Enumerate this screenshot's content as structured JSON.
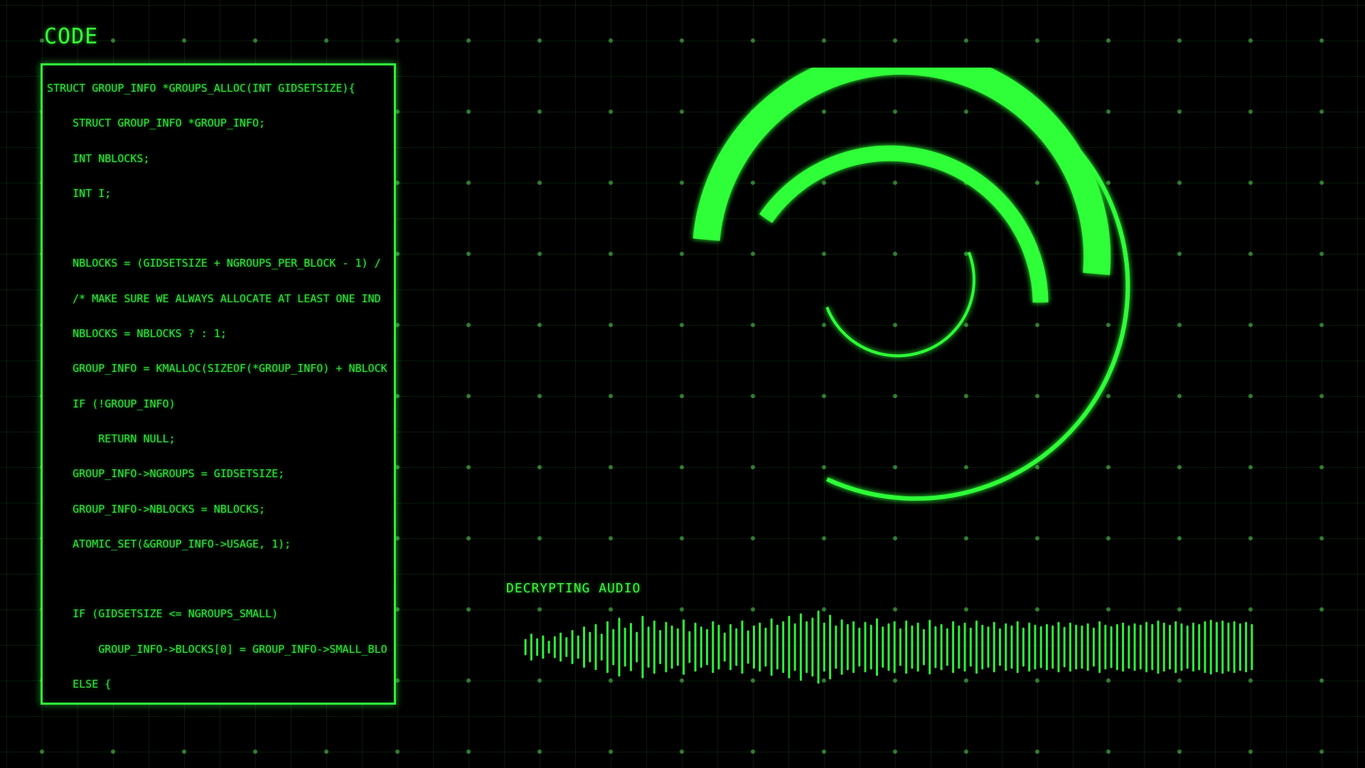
{
  "panel": {
    "title": "CODE",
    "lines": [
      "STRUCT GROUP_INFO *GROUPS_ALLOC(INT GIDSETSIZE){",
      "    STRUCT GROUP_INFO *GROUP_INFO;",
      "    INT NBLOCKS;",
      "    INT I;",
      "",
      "    NBLOCKS = (GIDSETSIZE + NGROUPS_PER_BLOCK - 1) /",
      "    /* MAKE SURE WE ALWAYS ALLOCATE AT LEAST ONE IND",
      "    NBLOCKS = NBLOCKS ? : 1;",
      "    GROUP_INFO = KMALLOC(SIZEOF(*GROUP_INFO) + NBLOCK",
      "    IF (!GROUP_INFO)",
      "        RETURN NULL;",
      "    GROUP_INFO->NGROUPS = GIDSETSIZE;",
      "    GROUP_INFO->NBLOCKS = NBLOCKS;",
      "    ATOMIC_SET(&GROUP_INFO->USAGE, 1);",
      "",
      "    IF (GIDSETSIZE <= NGROUPS_SMALL)",
      "        GROUP_INFO->BLOCKS[0] = GROUP_INFO->SMALL_BLO",
      "    ELSE {"
    ]
  },
  "audio": {
    "label": "DECRYPTING AUDIO",
    "amplitudes": [
      0.2,
      0.35,
      0.22,
      0.3,
      0.15,
      0.28,
      0.38,
      0.25,
      0.45,
      0.3,
      0.55,
      0.4,
      0.62,
      0.35,
      0.7,
      0.48,
      0.8,
      0.52,
      0.65,
      0.4,
      0.85,
      0.55,
      0.72,
      0.45,
      0.68,
      0.58,
      0.5,
      0.75,
      0.42,
      0.66,
      0.55,
      0.48,
      0.7,
      0.6,
      0.38,
      0.62,
      0.5,
      0.72,
      0.44,
      0.58,
      0.66,
      0.52,
      0.78,
      0.6,
      0.7,
      0.85,
      0.64,
      0.92,
      0.7,
      0.8,
      1.0,
      0.66,
      0.88,
      0.58,
      0.75,
      0.62,
      0.7,
      0.52,
      0.68,
      0.6,
      0.78,
      0.55,
      0.64,
      0.7,
      0.5,
      0.72,
      0.58,
      0.66,
      0.48,
      0.74,
      0.56,
      0.62,
      0.5,
      0.7,
      0.58,
      0.66,
      0.52,
      0.72,
      0.6,
      0.55,
      0.68,
      0.5,
      0.64,
      0.58,
      0.7,
      0.52,
      0.66,
      0.6,
      0.56,
      0.62,
      0.58,
      0.68,
      0.54,
      0.66,
      0.6,
      0.58,
      0.64,
      0.52,
      0.7,
      0.6,
      0.56,
      0.62,
      0.66,
      0.58,
      0.64,
      0.6,
      0.68,
      0.62,
      0.72,
      0.66,
      0.6,
      0.7,
      0.64,
      0.58,
      0.66,
      0.62,
      0.7,
      0.74,
      0.68,
      0.72,
      0.66,
      0.7,
      0.64,
      0.68,
      0.62
    ]
  },
  "colors": {
    "accent": "#2ff03a",
    "bright": "#3cff3c"
  }
}
